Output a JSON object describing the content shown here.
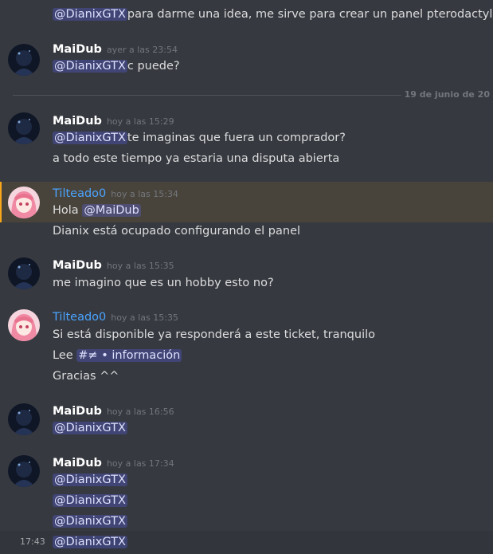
{
  "messages": {
    "m0": {
      "mention": "@DianixGTX",
      "text": "para darme una idea, me sirve para crear un panel pterodactyl?"
    },
    "m1": {
      "author": "MaiDub",
      "time": "ayer a las 23:54",
      "mention": "@DianixGTX",
      "text": "c puede?"
    },
    "date_divider": "19 de junio de 20",
    "m2": {
      "author": "MaiDub",
      "time": "hoy a las 15:29",
      "mention": "@DianixGTX",
      "text": "te imaginas que fuera un comprador?",
      "line2": "a todo este tiempo ya estaria una disputa abierta"
    },
    "m3": {
      "author": "Tilteado0",
      "time": "hoy a las 15:34",
      "prefix": "Hola ",
      "mention": "@MaiDub",
      "line2": "Dianix está ocupado configurando el panel"
    },
    "m4": {
      "author": "MaiDub",
      "time": "hoy a las 15:35",
      "text": "me imagino que es un hobby esto no?"
    },
    "m5": {
      "author": "Tilteado0",
      "time": "hoy a las 15:35",
      "text": "Si está disponible ya responderá a este ticket, tranquilo",
      "lee": "Lee ",
      "channel": "#≠ • información",
      "line3": "Gracias ^^"
    },
    "m6": {
      "author": "MaiDub",
      "time": "hoy a las 16:56",
      "mention": "@DianixGTX"
    },
    "m7": {
      "author": "MaiDub",
      "time": "hoy a las 17:34",
      "mentions": [
        "@DianixGTX",
        "@DianixGTX",
        "@DianixGTX",
        "@DianixGTX"
      ],
      "hover_time": "17:43"
    }
  },
  "colors": {
    "background": "#36393f",
    "mention_bg": "#414674",
    "username_tilt": "#4aa3ff",
    "highlight_bar": "#faa81a"
  }
}
